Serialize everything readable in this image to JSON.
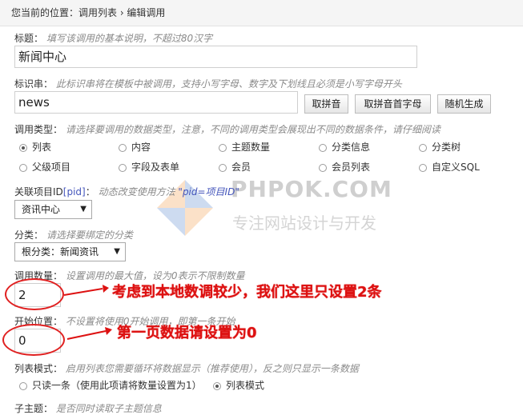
{
  "breadcrumb": "您当前的位置：调用列表 › 编辑调用",
  "title_field": {
    "label": "标题：",
    "hint": "填写该调用的基本说明，不超过80汉字",
    "value": "新闻中心"
  },
  "identifier_field": {
    "label": "标识串：",
    "hint": "此标识串将在模板中被调用，支持小写字母、数字及下划线且必须是小写字母开头",
    "value": "news",
    "buttons": [
      "取拼音",
      "取拼音首字母",
      "随机生成"
    ]
  },
  "type_field": {
    "label": "调用类型：",
    "hint": "请选择要调用的数据类型，注意，不同的调用类型会展现出不同的数据条件，请仔细阅读",
    "options_row1": [
      "列表",
      "内容",
      "主题数量",
      "分类信息",
      "分类树"
    ],
    "options_row2": [
      "父级项目",
      "字段及表单",
      "会员",
      "会员列表",
      "自定义SQL"
    ],
    "selected": "列表"
  },
  "project_field": {
    "label_prefix": "关联项目ID",
    "label_pid": "[pid]",
    "label_suffix": "：",
    "hint": "动态改变使用方法",
    "hint_code": "pid=项目ID",
    "value": "资讯中心"
  },
  "category_field": {
    "label": "分类：",
    "hint": "请选择要绑定的分类",
    "value": "根分类：新闻资讯"
  },
  "count_field": {
    "label": "调用数量：",
    "hint": "设置调用的最大值，设为0表示不限制数量",
    "value": "2"
  },
  "offset_field": {
    "label": "开始位置：",
    "hint": "不设置将使用0开始调用，即第一条开始",
    "value": "0"
  },
  "list_mode_field": {
    "label": "列表模式：",
    "hint": "启用列表您需要循环将数据显示（推荐使用），反之则只显示一条数据",
    "options": [
      "只读一条（使用此项请将数量设置为1）",
      "列表模式"
    ],
    "selected": "列表模式"
  },
  "sub_topic_field": {
    "label": "子主题：",
    "hint": "是否同时读取子主题信息"
  },
  "annotations": {
    "count_note": "考虑到本地数调较少，我们这里只设置2条",
    "offset_note": "第一页数据请设置为0"
  },
  "watermark": {
    "brand": "PHPOK.COM",
    "slogan": "专注网站设计与开发"
  },
  "colors": {
    "accent_red": "#dd1111",
    "hint_gray": "#8a8a8a",
    "pid_blue": "#4455bb"
  }
}
